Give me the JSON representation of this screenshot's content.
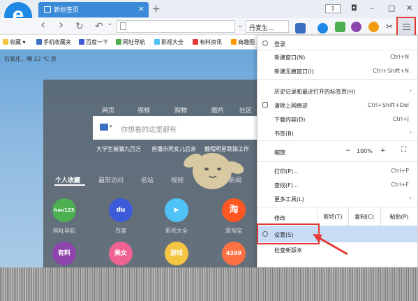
{
  "titlebar": {
    "tab_title": "新标签页",
    "tab_close": "×",
    "new_tab": "+",
    "tab_count": "1",
    "win_buttons": [
      "◘",
      "–",
      "□",
      "✕"
    ]
  },
  "navbar": {
    "back": "‹",
    "forward": "›",
    "refresh": "↻",
    "undo": "↶",
    "addr_dropdown": "⌄",
    "search_text": "丹麦生...",
    "scissors": "✂"
  },
  "bookmarks": {
    "favorites_label": "收藏",
    "items": [
      "手机收藏夹",
      "百度一下",
      "网址导航",
      "影视大全",
      "有料资讯",
      "商趣图"
    ]
  },
  "weather": {
    "text": "石家庄，晴  22 ℃ 良"
  },
  "search": {
    "tabs": [
      "网页",
      "视频",
      "购物",
      "图片",
      "社区"
    ],
    "placeholder": "你想看的这里都有",
    "hot": [
      "大学生被骗九百万",
      "直播示死女儿后亲",
      "戴帽明星跳操工作"
    ]
  },
  "categories": [
    "个人收藏",
    "最常访问",
    "名站",
    "视频",
    "购物",
    "新闻"
  ],
  "apps": [
    {
      "label": "hao123",
      "name": "网址导航",
      "color": "#4caf50"
    },
    {
      "label": "du",
      "name": "百度",
      "color": "#3d5ad8"
    },
    {
      "label": "▶",
      "name": "影视大全",
      "color": "#4fc3f7"
    },
    {
      "label": "淘",
      "name": "爱淘宝",
      "color": "#ff5722"
    }
  ],
  "apps_row2": [
    {
      "label": "有料",
      "color": "#8e44ad"
    },
    {
      "label": "美女",
      "color": "#f06292"
    },
    {
      "label": "游戏",
      "color": "#f4c542"
    },
    {
      "label": "4399",
      "color": "#ff7043"
    }
  ],
  "menu": {
    "login": "登录",
    "new_window": "新建窗口(N)",
    "new_window_key": "Ctrl+N",
    "new_incognito": "新建无痕窗口(I)",
    "new_incognito_key": "Ctrl+Shift+N",
    "history": "历史记录和最近打开的标签页(H)",
    "clear": "清除上网痕迹",
    "clear_key": "Ctrl+Shift+Del",
    "downloads": "下载内容(D)",
    "downloads_key": "Ctrl+J",
    "bookmarks": "书签(B)",
    "zoom": "缩放",
    "zoom_minus": "−",
    "zoom_value": "100%",
    "zoom_plus": "+",
    "zoom_full": "⛶",
    "print": "打印(P)...",
    "print_key": "Ctrl+P",
    "find": "查找(F)...",
    "find_key": "Ctrl+F",
    "more_tools": "更多工具(L)",
    "edit": "修改",
    "cut": "剪切(T)",
    "copy": "复制(C)",
    "paste": "粘贴(P)",
    "settings": "设置(S)",
    "check_update": "检查新版本",
    "arrow": "›"
  }
}
